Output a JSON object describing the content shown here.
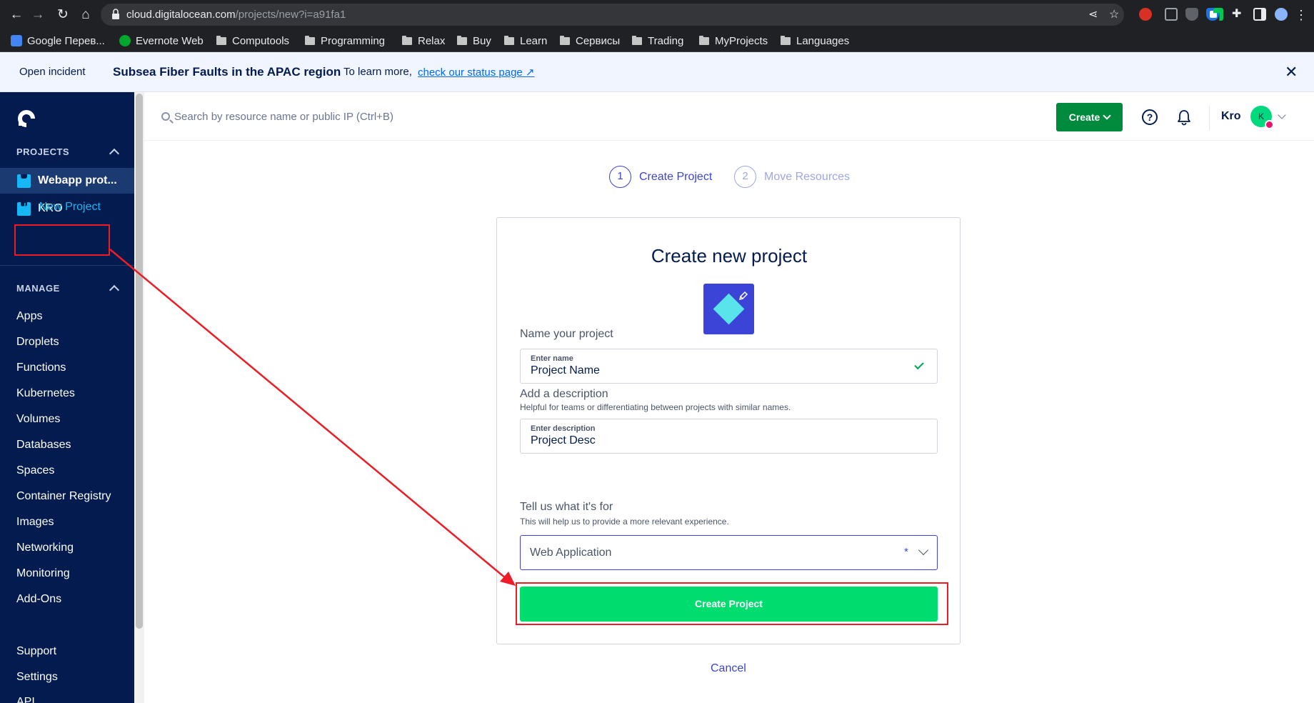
{
  "browser": {
    "url_domain": "cloud.digitalocean.com",
    "url_path": "/projects/new?i=a91fa1",
    "bookmarks": [
      {
        "label": "Google Перев...",
        "icon": "google-translate-icon"
      },
      {
        "label": "Evernote Web",
        "icon": "evernote-icon"
      },
      {
        "label": "Computools",
        "icon": "folder-icon"
      },
      {
        "label": "Programming",
        "icon": "folder-icon"
      },
      {
        "label": "Relax",
        "icon": "folder-icon"
      },
      {
        "label": "Buy",
        "icon": "folder-icon"
      },
      {
        "label": "Learn",
        "icon": "folder-icon"
      },
      {
        "label": "Сервисы",
        "icon": "folder-icon"
      },
      {
        "label": "Trading",
        "icon": "folder-icon"
      },
      {
        "label": "MyProjects",
        "icon": "folder-icon"
      },
      {
        "label": "Languages",
        "icon": "folder-icon"
      }
    ]
  },
  "banner": {
    "label": "Open incident",
    "title": "Subsea Fiber Faults in the APAC region",
    "learn_more": "To learn more,",
    "link_text": "check our status page ↗"
  },
  "sidebar": {
    "projects_title": "PROJECTS",
    "projects": [
      {
        "label": "Webapp prot...",
        "active": true
      },
      {
        "label": "KRO",
        "active": false
      }
    ],
    "new_project": {
      "plus": "+",
      "label": "New Project"
    },
    "manage_title": "MANAGE",
    "manage_items": [
      "Apps",
      "Droplets",
      "Functions",
      "Kubernetes",
      "Volumes",
      "Databases",
      "Spaces",
      "Container Registry",
      "Images",
      "Networking",
      "Monitoring",
      "Add-Ons"
    ],
    "footer_items": [
      "Support",
      "Settings",
      "API"
    ]
  },
  "header": {
    "search_placeholder": "Search by resource name or public IP (Ctrl+B)",
    "create_label": "Create",
    "help_glyph": "?",
    "user_name": "Kro",
    "avatar_initial": "K"
  },
  "stepper": [
    {
      "number": "1",
      "label": "Create Project"
    },
    {
      "number": "2",
      "label": "Move Resources"
    }
  ],
  "form": {
    "title": "Create new project",
    "name_section": "Name your project",
    "name_label": "Enter name",
    "name_value": "Project Name",
    "desc_section": "Add a description",
    "desc_help": "Helpful for teams or differentiating between projects with similar names.",
    "desc_label": "Enter description",
    "desc_value": "Project Desc",
    "purpose_section": "Tell us what it's for",
    "purpose_help": "This will help us to provide a more relevant experience.",
    "purpose_value": "Web Application",
    "purpose_required": "*",
    "submit_label": "Create Project",
    "cancel_label": "Cancel"
  },
  "colors": {
    "sidebar_bg": "#031b4e",
    "brand_blue": "#3b44d7",
    "create_green": "#008a3e",
    "submit_green": "#00dd6f",
    "annotation_red": "#ee1c25"
  }
}
